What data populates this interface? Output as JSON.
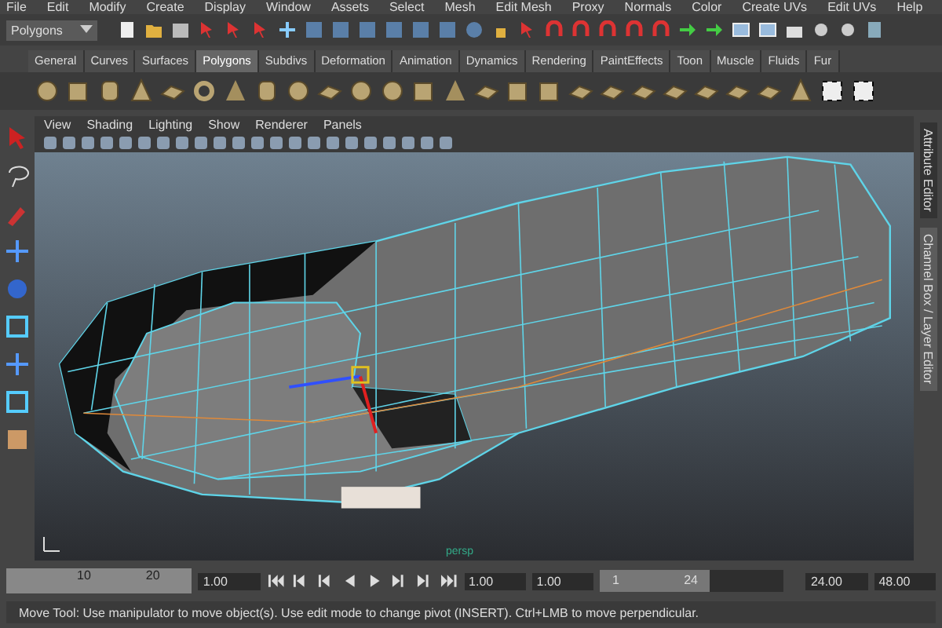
{
  "menu_bar": [
    "File",
    "Edit",
    "Modify",
    "Create",
    "Display",
    "Window",
    "Assets",
    "Select",
    "Mesh",
    "Edit Mesh",
    "Proxy",
    "Normals",
    "Color",
    "Create UVs",
    "Edit UVs",
    "Help"
  ],
  "status_line": {
    "mode": "Polygons"
  },
  "shelf_tabs": [
    {
      "label": "General",
      "selected": false
    },
    {
      "label": "Curves",
      "selected": false
    },
    {
      "label": "Surfaces",
      "selected": false
    },
    {
      "label": "Polygons",
      "selected": true
    },
    {
      "label": "Subdivs",
      "selected": false
    },
    {
      "label": "Deformation",
      "selected": false
    },
    {
      "label": "Animation",
      "selected": false
    },
    {
      "label": "Dynamics",
      "selected": false
    },
    {
      "label": "Rendering",
      "selected": false
    },
    {
      "label": "PaintEffects",
      "selected": false
    },
    {
      "label": "Toon",
      "selected": false
    },
    {
      "label": "Muscle",
      "selected": false
    },
    {
      "label": "Fluids",
      "selected": false
    },
    {
      "label": "Fur",
      "selected": false
    }
  ],
  "panel_menu": [
    "View",
    "Shading",
    "Lighting",
    "Show",
    "Renderer",
    "Panels"
  ],
  "viewport": {
    "camera": "persp"
  },
  "side_tabs": [
    {
      "label": "Attribute Editor",
      "selected": false
    },
    {
      "label": "Channel Box / Layer Editor",
      "selected": true
    }
  ],
  "time_slider": {
    "ticks": [
      "10",
      "20"
    ],
    "current_time": "1.00"
  },
  "range": {
    "start_time": "1.00",
    "playback_start": "1.00",
    "range_start": "1",
    "range_end": "24",
    "level": 0.6,
    "playback_end": "24.00",
    "end_time": "48.00"
  },
  "help_line": "Move Tool: Use manipulator to move object(s). Use edit mode to change pivot (INSERT).  Ctrl+LMB to move perpendicular."
}
